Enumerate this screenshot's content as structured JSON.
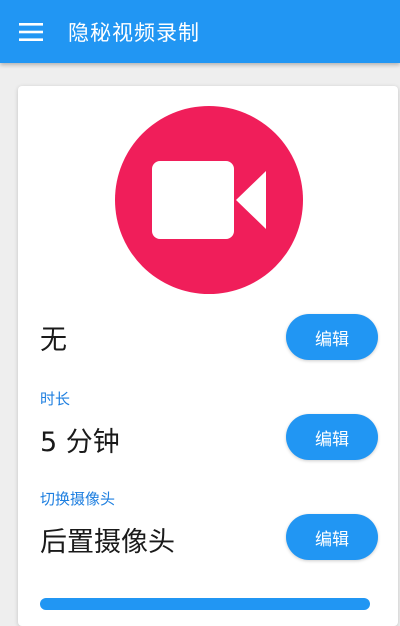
{
  "app_bar": {
    "title": "隐秘视频录制",
    "menu_icon": "hamburger-menu-icon",
    "color": "#2196f3"
  },
  "camera": {
    "icon": "video-camera-icon",
    "circle_color": "#f01e5a"
  },
  "settings": [
    {
      "label": "",
      "value": "无",
      "button": "编辑"
    },
    {
      "label": "时长",
      "value": "5 分钟",
      "button": "编辑"
    },
    {
      "label": "切换摄像头",
      "value": "后置摄像头",
      "button": "编辑"
    }
  ]
}
